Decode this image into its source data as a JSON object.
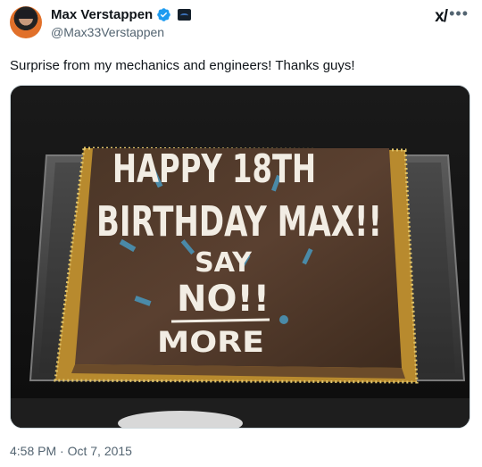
{
  "author": {
    "display_name": "Max Verstappen",
    "handle": "@Max33Verstappen"
  },
  "tweet": {
    "text": "Surprise from my mechanics and engineers! Thanks guys!",
    "timestamp": "4:58 PM · Oct 7, 2015"
  },
  "icons": {
    "verified": "verified-badge-icon",
    "affiliation": "affiliation-badge-icon",
    "grok": "grok-icon",
    "more": "more-icon"
  },
  "cake": {
    "line1": "HAPPY 18TH",
    "line2": "BIRTHDAY MAX!!",
    "line3": "SAY",
    "line4": "NO!!",
    "line5": "MORE"
  },
  "colors": {
    "verified_blue": "#1d9bf0",
    "secondary_text": "#536471"
  }
}
